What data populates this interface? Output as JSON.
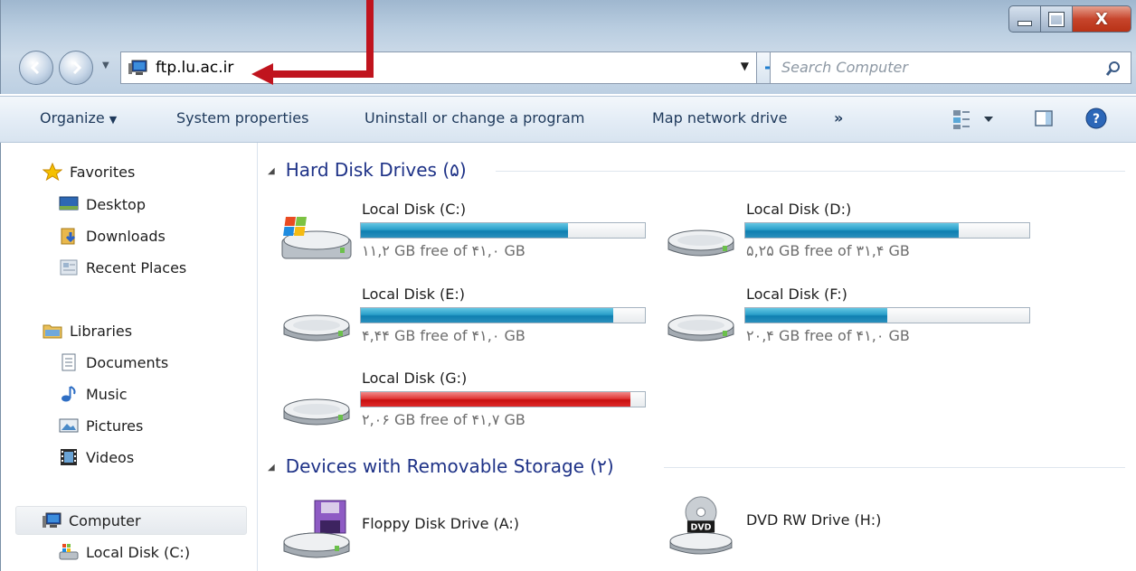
{
  "window": {
    "close_glyph": "X"
  },
  "address_bar": {
    "path": "ftp.lu.ac.ir",
    "search_placeholder": "Search Computer"
  },
  "command_bar": {
    "organize": "Organize",
    "system_properties": "System properties",
    "uninstall": "Uninstall or change a program",
    "map_drive": "Map network drive",
    "more": "»"
  },
  "sidebar": {
    "favorites": {
      "label": "Favorites",
      "items": [
        {
          "label": "Desktop",
          "icon": "desktop-icon"
        },
        {
          "label": "Downloads",
          "icon": "downloads-icon"
        },
        {
          "label": "Recent Places",
          "icon": "recent-places-icon"
        }
      ]
    },
    "libraries": {
      "label": "Libraries",
      "items": [
        {
          "label": "Documents",
          "icon": "documents-icon"
        },
        {
          "label": "Music",
          "icon": "music-icon"
        },
        {
          "label": "Pictures",
          "icon": "pictures-icon"
        },
        {
          "label": "Videos",
          "icon": "videos-icon"
        }
      ]
    },
    "computer": {
      "label": "Computer",
      "items": [
        {
          "label": "Local Disk (C:)",
          "icon": "local-disk-icon"
        }
      ]
    }
  },
  "content": {
    "hard_disks": {
      "title": "Hard Disk Drives (۵)",
      "drives": [
        {
          "name": "Local Disk (C:)",
          "free_text": "۱۱,۲ GB free of ۴۱,۰ GB",
          "used_fraction": 0.73,
          "status": "normal",
          "icon": "windows-drive-icon"
        },
        {
          "name": "Local Disk (D:)",
          "free_text": "۵,۲۵ GB free of ۳۱,۴ GB",
          "used_fraction": 0.75,
          "status": "normal",
          "icon": "hard-drive-icon"
        },
        {
          "name": "Local Disk (E:)",
          "free_text": "۴,۴۴ GB free of ۴۱,۰ GB",
          "used_fraction": 0.89,
          "status": "normal",
          "icon": "hard-drive-icon"
        },
        {
          "name": "Local Disk (F:)",
          "free_text": "۲۰,۴ GB free of ۴۱,۰ GB",
          "used_fraction": 0.5,
          "status": "normal",
          "icon": "hard-drive-icon"
        },
        {
          "name": "Local Disk (G:)",
          "free_text": "۲,۰۶ GB free of ۴۱,۷ GB",
          "used_fraction": 0.95,
          "status": "low",
          "icon": "hard-drive-icon"
        }
      ]
    },
    "removable": {
      "title": "Devices with Removable Storage (۲)",
      "devices": [
        {
          "name": "Floppy Disk Drive (A:)",
          "icon": "floppy-drive-icon"
        },
        {
          "name": "DVD RW Drive (H:)",
          "icon": "dvd-drive-icon",
          "badge": "DVD"
        }
      ]
    }
  },
  "colors": {
    "bar_normal": "#1e8fc0",
    "bar_low": "#d42020",
    "group_title": "#1e3287",
    "annotation": "#c0141e"
  }
}
